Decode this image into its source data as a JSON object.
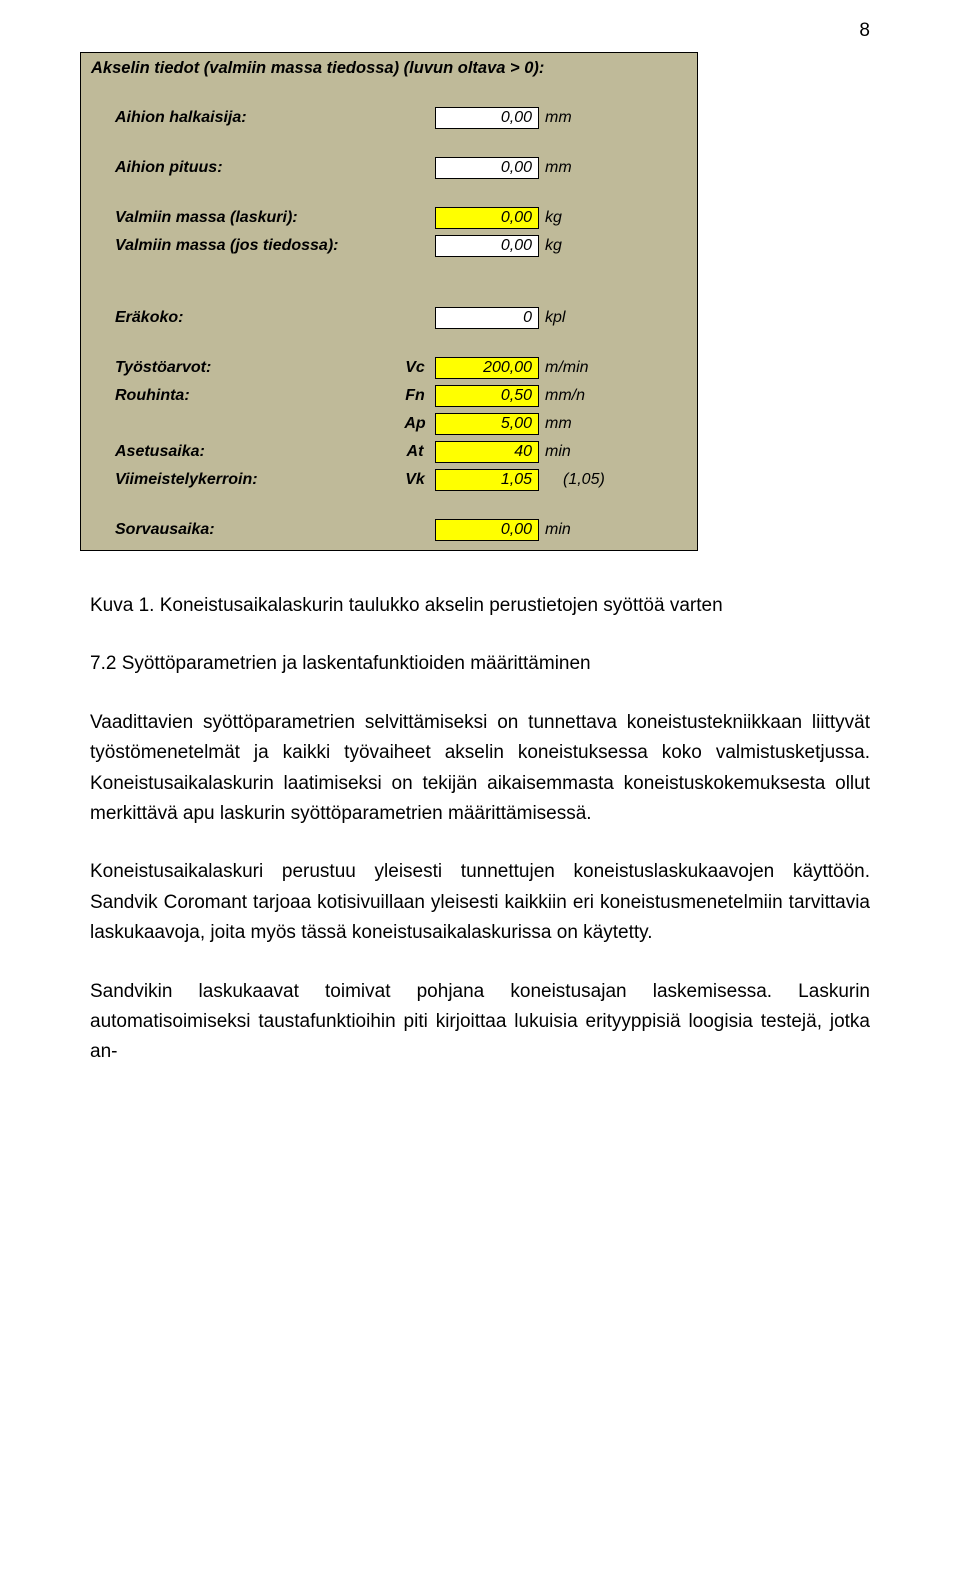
{
  "page_number": "8",
  "form": {
    "title": "Akselin tiedot (valmiin massa tiedossa) (luvun oltava > 0):",
    "rows": {
      "aihion_halkaisija": {
        "label": "Aihion halkaisija:",
        "value": "0,00",
        "unit": "mm"
      },
      "aihion_pituus": {
        "label": "Aihion pituus:",
        "value": "0,00",
        "unit": "mm"
      },
      "valmiin_massa_laskuri": {
        "label": "Valmiin massa (laskuri):",
        "value": "0,00",
        "unit": "kg"
      },
      "valmiin_massa_tiedossa": {
        "label": "Valmiin massa (jos tiedossa):",
        "value": "0,00",
        "unit": "kg"
      },
      "erakoko": {
        "label": "Eräkoko:",
        "value": "0",
        "unit": "kpl"
      },
      "tyostoarvot": {
        "label": "Työstöarvot:",
        "short": "Vc",
        "value": "200,00",
        "unit": "m/min"
      },
      "rouhinta": {
        "label": "Rouhinta:",
        "short": "Fn",
        "value": "0,50",
        "unit": "mm/n"
      },
      "ap": {
        "label": "",
        "short": "Ap",
        "value": "5,00",
        "unit": "mm"
      },
      "asetusaika": {
        "label": "Asetusaika:",
        "short": "At",
        "value": "40",
        "unit": "min"
      },
      "viimeistelykerroin": {
        "label": "Viimeistelykerroin:",
        "short": "Vk",
        "value": "1,05",
        "extra": "(1,05)"
      },
      "sorvausaika": {
        "label": "Sorvausaika:",
        "value": "0,00",
        "unit": "min"
      }
    }
  },
  "caption": "Kuva 1.   Koneistusaikalaskurin taulukko akselin perustietojen syöttöä varten",
  "paragraphs": {
    "p1": "7.2  Syöttöparametrien ja laskentafunktioiden määrittäminen",
    "p2": "Vaadittavien syöttöparametrien selvittämiseksi on tunnettava koneistustekniikkaan liittyvät työstömenetelmät ja kaikki työvaiheet akselin koneistuksessa koko valmistusketjussa. Koneistusaikalaskurin laatimiseksi on tekijän aikaisemmasta koneistuskokemuksesta ollut merkittävä apu laskurin syöttöparametrien määrittämisessä.",
    "p3": "Koneistusaikalaskuri perustuu yleisesti tunnettujen koneistuslaskukaavojen käyttöön. Sandvik Coromant tarjoaa kotisivuillaan yleisesti kaikkiin eri koneistusmenetelmiin tarvittavia laskukaavoja, joita myös tässä koneistusaikalaskurissa on käytetty.",
    "p4": "Sandvikin laskukaavat toimivat pohjana koneistusajan laskemisessa. Laskurin automatisoimiseksi taustafunktioihin piti kirjoittaa lukuisia erityyppisiä loogisia testejä, jotka an-"
  }
}
